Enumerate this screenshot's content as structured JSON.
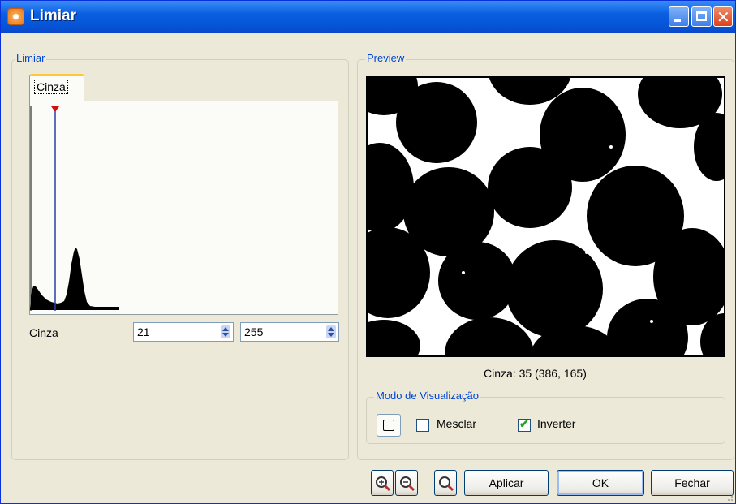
{
  "window": {
    "title": "Limiar",
    "icon": "app-icon"
  },
  "left_panel": {
    "legend": "Limiar",
    "tabs": [
      {
        "label": "Cinza"
      }
    ],
    "histogram": {
      "threshold_marker": 21,
      "range": [
        0,
        255
      ]
    },
    "channel_label": "Cinza",
    "min_value": "21",
    "max_value": "255"
  },
  "preview": {
    "legend": "Preview",
    "readout": "Cinza: 35 (386, 165)"
  },
  "view_mode": {
    "legend": "Modo de Visualização",
    "color_button_icon": "square-icon",
    "mesclar_label": "Mesclar",
    "mesclar_checked": false,
    "inverter_label": "Inverter",
    "inverter_checked": true
  },
  "buttons": {
    "zoom_in_icon": "zoom-in-icon",
    "zoom_out_icon": "zoom-out-icon",
    "zoom_fit_icon": "zoom-icon",
    "apply": "Aplicar",
    "ok": "OK",
    "close": "Fechar"
  },
  "colors": {
    "title_bar": "#0a5fe0",
    "group_legend": "#0046d5",
    "tab_accent": "#ffc83c"
  }
}
